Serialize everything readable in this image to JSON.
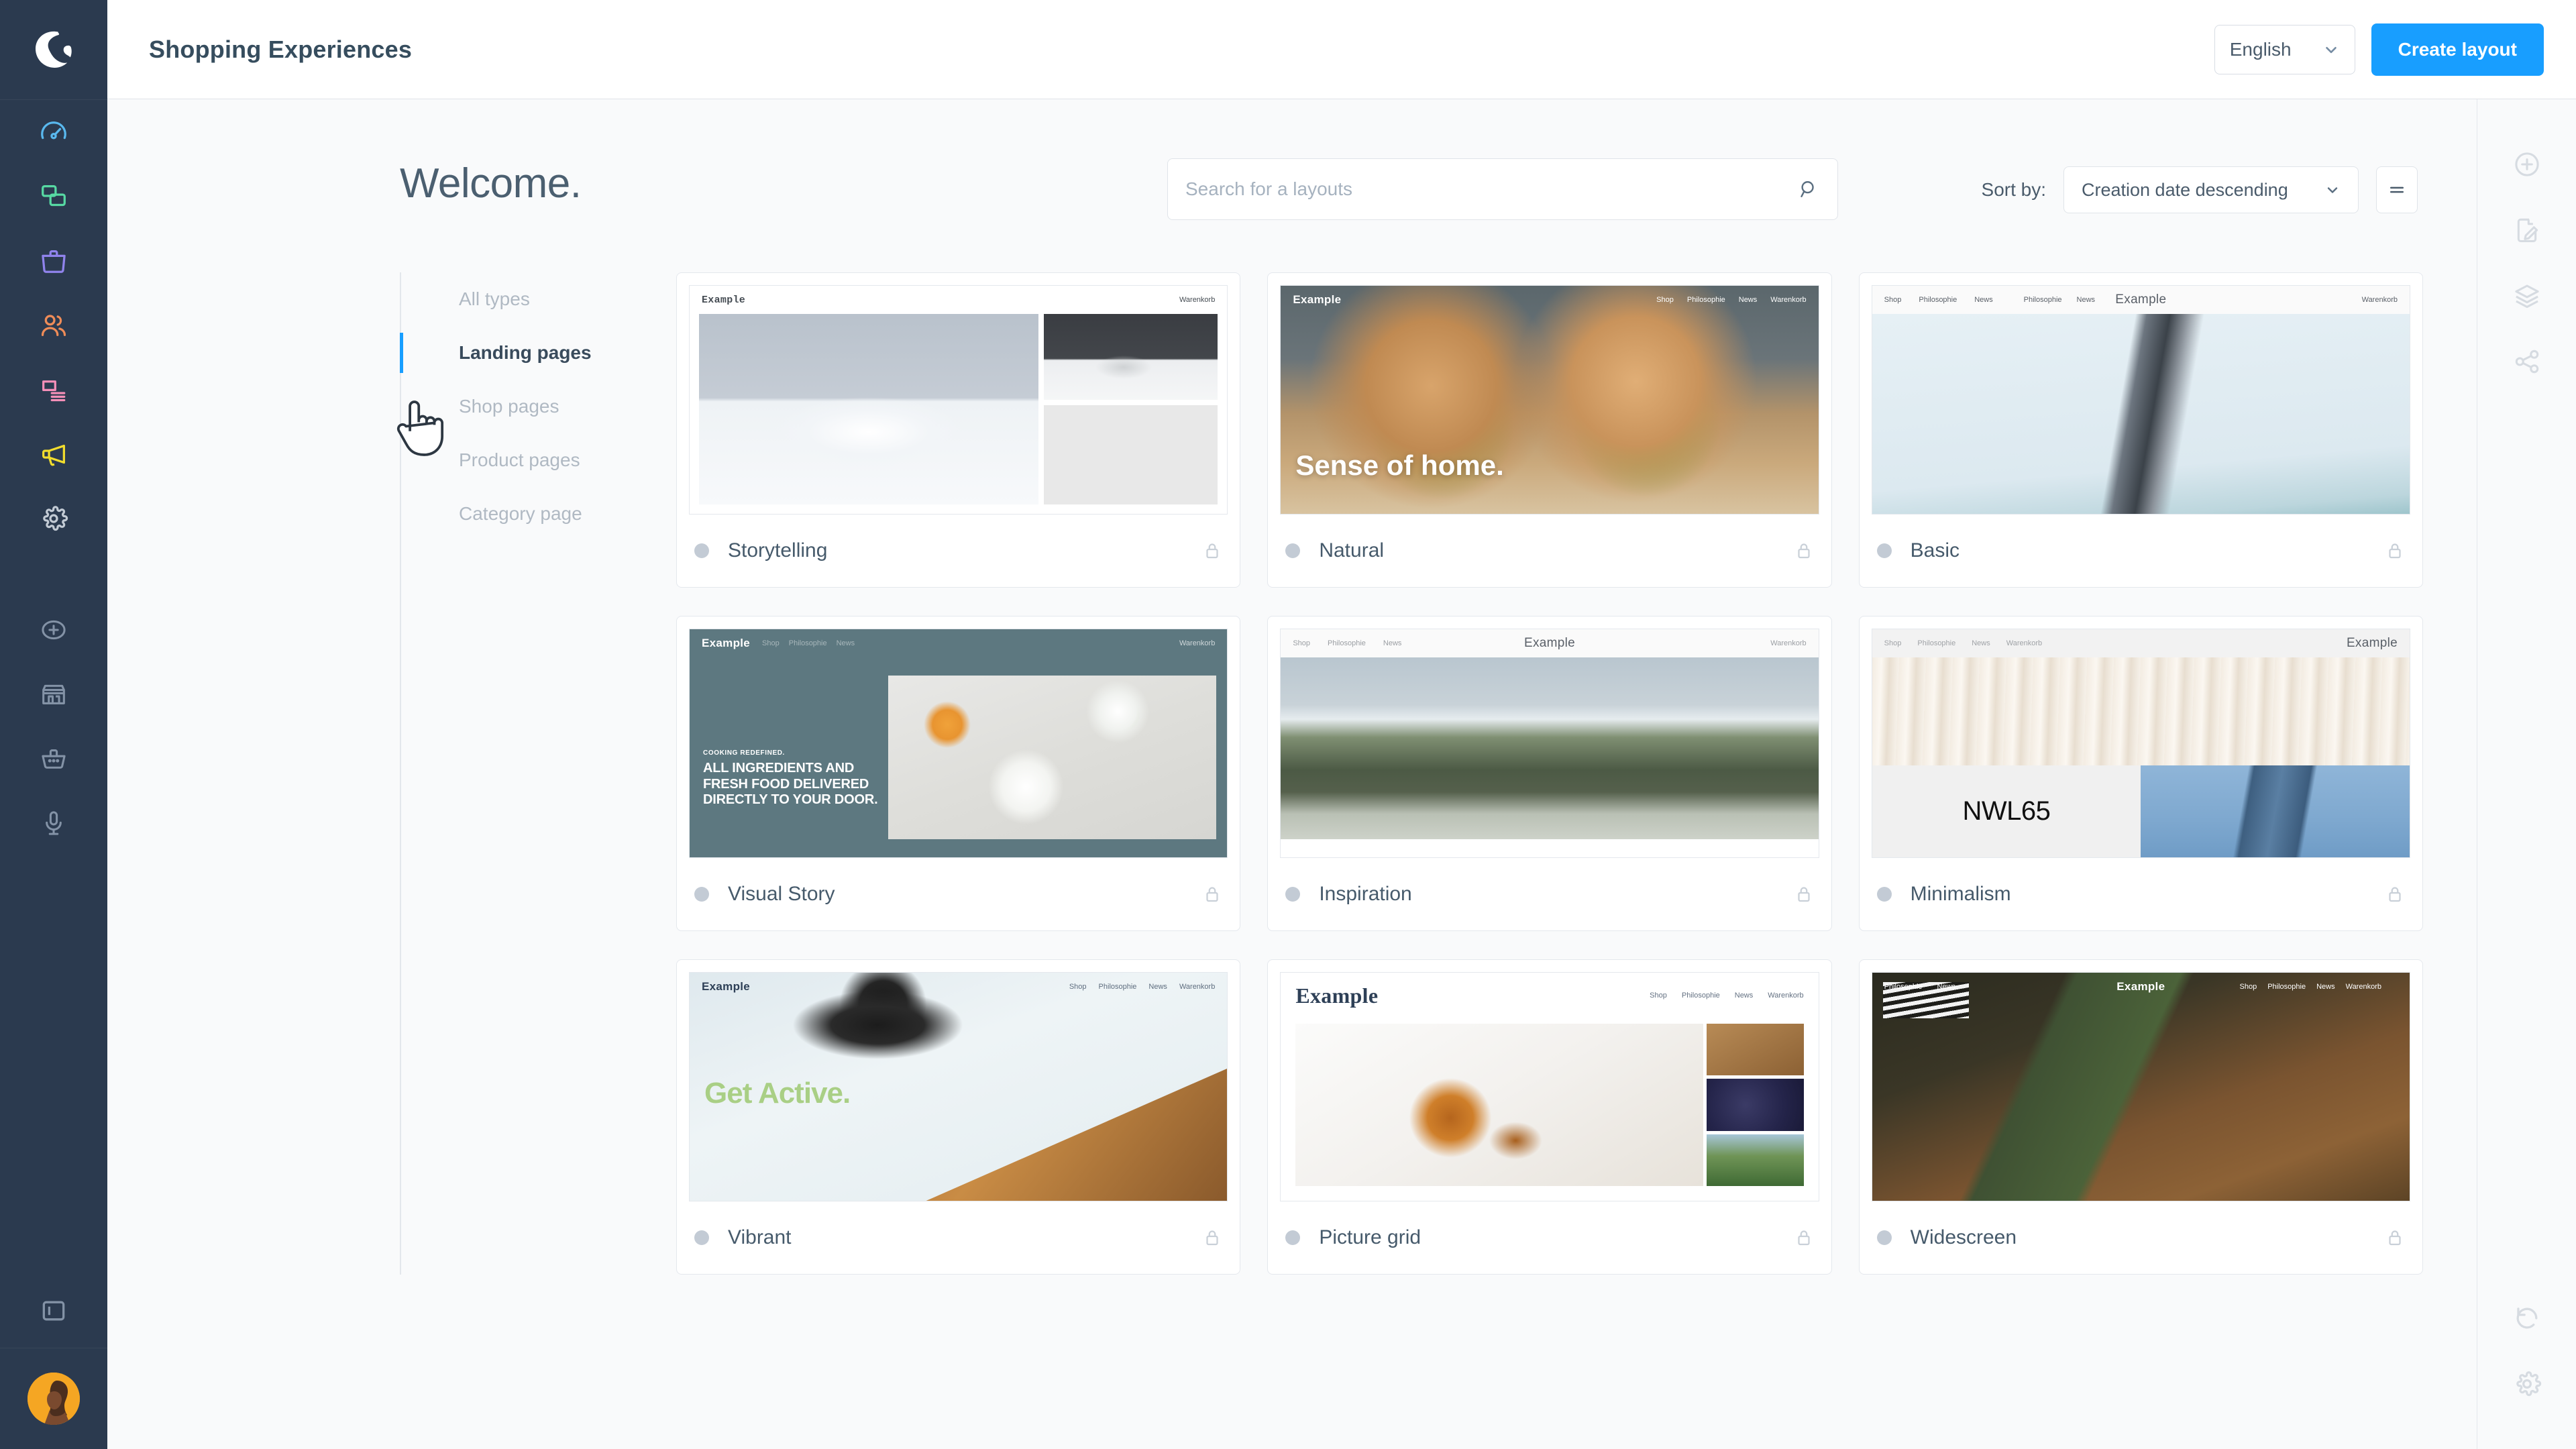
{
  "app": {
    "logo_icon": "shopware-logo-icon",
    "accent_color": "#189eff",
    "sidebar_bg": "#2b3a4f"
  },
  "header": {
    "title": "Shopping Experiences",
    "language": {
      "value": "English",
      "chevron_icon": "chevron-down-icon"
    },
    "create_button": "Create layout"
  },
  "left_sidebar": {
    "primary_items": [
      {
        "name": "dashboard",
        "icon": "speedometer-icon",
        "color": "#59b8ee"
      },
      {
        "name": "catalogues",
        "icon": "stacked-squares-icon",
        "color": "#57d9a3"
      },
      {
        "name": "orders",
        "icon": "briefcase-icon",
        "color": "#9083ec"
      },
      {
        "name": "customers",
        "icon": "people-icon",
        "color": "#ef8c58"
      },
      {
        "name": "content",
        "icon": "content-blocks-icon",
        "color": "#f48fb8"
      },
      {
        "name": "marketing",
        "icon": "megaphone-icon",
        "color": "#f2dd2d"
      },
      {
        "name": "settings",
        "icon": "gear-icon",
        "color": "#c2cad4"
      }
    ],
    "secondary_items": [
      {
        "name": "add",
        "icon": "plus-circle-icon"
      },
      {
        "name": "storefront",
        "icon": "store-icon"
      },
      {
        "name": "basket",
        "icon": "shopping-basket-icon"
      },
      {
        "name": "voice",
        "icon": "microphone-icon"
      }
    ],
    "collapse_icon": "collapse-sidebar-icon",
    "avatar_icon": "user-avatar"
  },
  "toolbar": {
    "welcome": "Welcome.",
    "search": {
      "value": "",
      "placeholder": "Search for a layouts",
      "icon": "search-icon"
    },
    "sort_label": "Sort by:",
    "sort_value": "Creation date descending",
    "sort_chevron_icon": "chevron-down-icon",
    "view_toggle_icon": "list-view-icon"
  },
  "filters": [
    {
      "label": "All types",
      "active": false
    },
    {
      "label": "Landing pages",
      "active": true
    },
    {
      "label": "Shop pages",
      "active": false
    },
    {
      "label": "Product pages",
      "active": false
    },
    {
      "label": "Category page",
      "active": false
    }
  ],
  "layouts": [
    {
      "name": "Storytelling",
      "lock_icon": "lock-icon",
      "status_dot": "#c3cbd5",
      "preview": {
        "brand": "Example",
        "brand_align": "left",
        "nav": [
          "Warenkorb"
        ],
        "bar_bg": "#ffffff",
        "bar_text": "#444b52",
        "body_bg": "#ffffff",
        "headline": ""
      }
    },
    {
      "name": "Natural",
      "lock_icon": "lock-icon",
      "status_dot": "#c3cbd5",
      "preview": {
        "brand": "Example",
        "brand_align": "left",
        "nav": [
          "Shop",
          "Philosophie",
          "News",
          "Warenkorb"
        ],
        "bar_bg": "transparent",
        "bar_text": "#ffffff",
        "body_bg": "#5b676c",
        "headline": "Sense of home."
      }
    },
    {
      "name": "Basic",
      "lock_icon": "lock-icon",
      "status_dot": "#c3cbd5",
      "preview": {
        "brand": "Example",
        "brand_align": "center",
        "nav": [
          "Shop",
          "Philosophie",
          "News",
          "Philosophie",
          "News",
          "Warenkorb"
        ],
        "bar_bg": "#fafafa",
        "bar_text": "#5a6068",
        "body_bg": "#dcebf1",
        "headline": ""
      }
    },
    {
      "name": "Visual Story",
      "lock_icon": "lock-icon",
      "status_dot": "#c3cbd5",
      "preview": {
        "brand": "Example",
        "brand_align": "left",
        "nav": [
          "Shop",
          "Philosophie",
          "News",
          "Warenkorb"
        ],
        "bar_bg": "transparent",
        "bar_text": "#ffffff",
        "body_bg": "#5d7880",
        "eyebrow": "COOKING REDEFINED.",
        "headline": "ALL INGREDIENTS AND FRESH FOOD DELIVERED DIRECTLY TO YOUR DOOR."
      }
    },
    {
      "name": "Inspiration",
      "lock_icon": "lock-icon",
      "status_dot": "#c3cbd5",
      "preview": {
        "brand": "Example",
        "brand_align": "center",
        "nav": [
          "Shop",
          "Philosophie",
          "News",
          "Warenkorb"
        ],
        "bar_bg": "#fafafa",
        "bar_text": "#5a6068",
        "body_bg": "#ffffff",
        "headline": ""
      }
    },
    {
      "name": "Minimalism",
      "lock_icon": "lock-icon",
      "status_dot": "#c3cbd5",
      "preview": {
        "brand": "Example",
        "brand_align": "right",
        "nav": [
          "Shop",
          "Philosophie",
          "News",
          "Warenkorb"
        ],
        "bar_bg": "#f2f2f2",
        "bar_text": "#5a6068",
        "body_bg": "#f0f0f0",
        "headline": "NWL65"
      }
    },
    {
      "name": "Vibrant",
      "lock_icon": "lock-icon",
      "status_dot": "#c3cbd5",
      "preview": {
        "brand": "Example",
        "brand_align": "left",
        "nav": [
          "Shop",
          "Philosophie",
          "News",
          "Warenkorb"
        ],
        "bar_bg": "transparent",
        "bar_text": "#2e4057",
        "body_bg": "#e3edf0",
        "headline": "Get Active.",
        "headline_color": "#a9cf85"
      }
    },
    {
      "name": "Picture grid",
      "lock_icon": "lock-icon",
      "status_dot": "#c3cbd5",
      "preview": {
        "brand": "Example",
        "brand_align": "left",
        "nav": [
          "Shop",
          "Philosophie",
          "News",
          "Warenkorb"
        ],
        "bar_bg": "#ffffff",
        "bar_text": "#2e4057",
        "body_bg": "#ffffff",
        "headline": ""
      }
    },
    {
      "name": "Widescreen",
      "lock_icon": "lock-icon",
      "status_dot": "#c3cbd5",
      "preview": {
        "brand": "Example",
        "brand_align": "center",
        "nav": [
          "Shop",
          "Philosophie",
          "News",
          "Warenkorb"
        ],
        "bar_bg": "transparent",
        "bar_text": "#ffffff",
        "body_bg": "#3a3626",
        "headline": ""
      }
    }
  ],
  "right_sidebar": {
    "top_items": [
      {
        "name": "add-element",
        "icon": "plus-circle-icon"
      },
      {
        "name": "edit-content",
        "icon": "document-edit-icon"
      },
      {
        "name": "layers",
        "icon": "layers-icon"
      },
      {
        "name": "share",
        "icon": "share-icon"
      }
    ],
    "bottom_items": [
      {
        "name": "history",
        "icon": "undo-history-icon"
      },
      {
        "name": "settings",
        "icon": "gear-icon"
      }
    ]
  },
  "cursor": {
    "icon": "pointing-hand-cursor"
  }
}
